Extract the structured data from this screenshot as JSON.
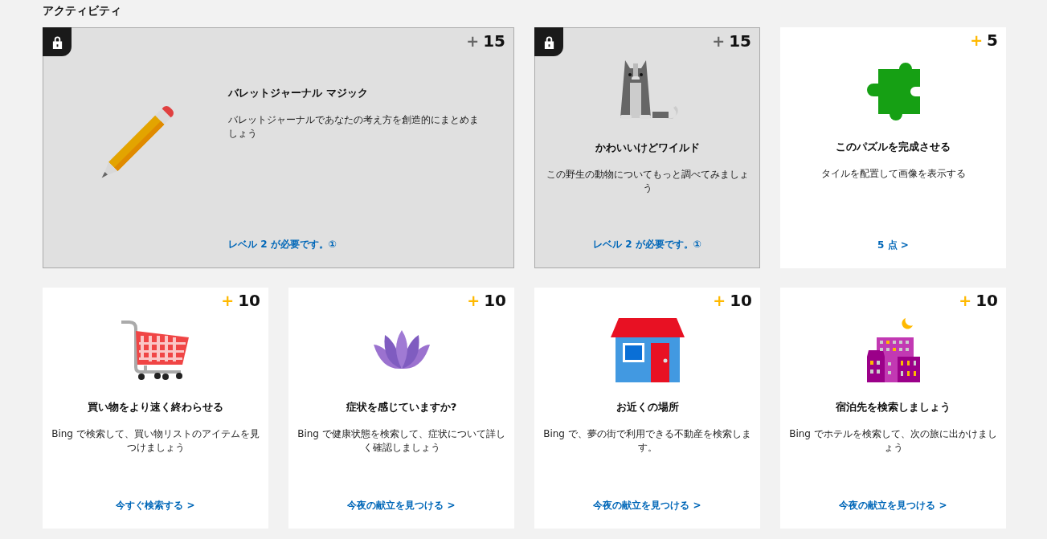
{
  "heading": "アクティビティ",
  "cards": [
    {
      "locked": true,
      "plus": "+",
      "points": "15",
      "title": "バレットジャーナル マジック",
      "description": "バレットジャーナルであなたの考え方を創造的にまとめましょう",
      "link": "レベル 2 が必要です。①"
    },
    {
      "locked": true,
      "plus": "+",
      "points": "15",
      "title": "かわいいけどワイルド",
      "description": "この野生の動物についてもっと調べてみましょう",
      "link": "レベル 2 が必要です。①"
    },
    {
      "locked": false,
      "plus": "+",
      "points": "5",
      "title": "このパズルを完成させる",
      "description": "タイルを配置して画像を表示する",
      "link": "5 点 >"
    },
    {
      "locked": false,
      "plus": "+",
      "points": "10",
      "title": "買い物をより速く終わらせる",
      "description": "Bing で検索して、買い物リストのアイテムを見つけましょう",
      "link": "今すぐ検索する >"
    },
    {
      "locked": false,
      "plus": "+",
      "points": "10",
      "title": "症状を感じていますか?",
      "description": "Bing で健康状態を検索して、症状について詳しく確認しましょう",
      "link": "今夜の献立を見つける >"
    },
    {
      "locked": false,
      "plus": "+",
      "points": "10",
      "title": "お近くの場所",
      "description": "Bing で、夢の街で利用できる不動産を検索します。",
      "link": "今夜の献立を見つける >"
    },
    {
      "locked": false,
      "plus": "+",
      "points": "10",
      "title": "宿泊先を検索しましょう",
      "description": "Bing でホテルを検索して、次の旅に出かけましょう",
      "link": "今夜の献立を見つける >"
    }
  ]
}
